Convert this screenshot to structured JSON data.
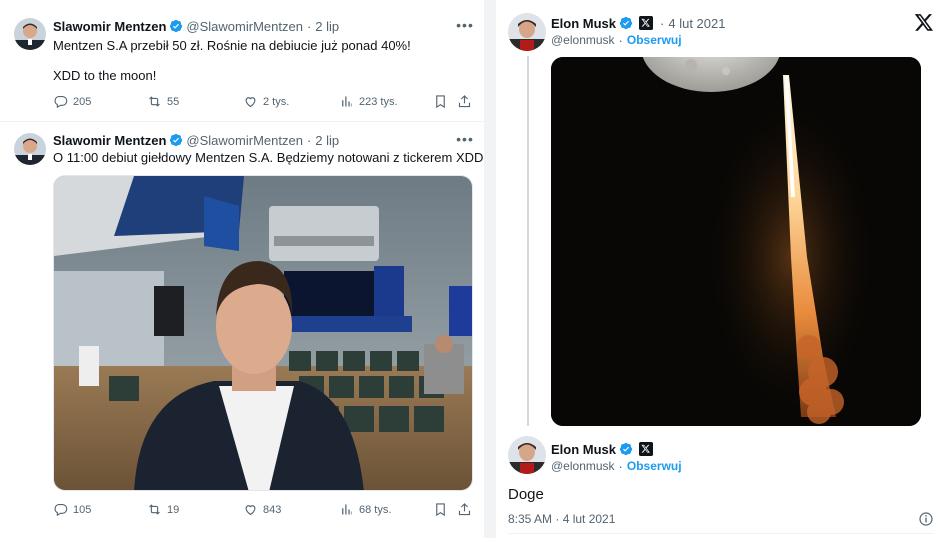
{
  "left_feed": {
    "tweets": [
      {
        "author": "Slawomir Mentzen",
        "handle": "@SlawomirMentzen",
        "separator": "·",
        "date": "2 lip",
        "line1": "Mentzen S.A przebił 50 zł. Rośnie na debiucie już ponad 40%!",
        "line2": "XDD to the moon!",
        "replies": "205",
        "retweets": "55",
        "likes": "2 tys.",
        "views": "223 tys."
      },
      {
        "author": "Slawomir Mentzen",
        "handle": "@SlawomirMentzen",
        "separator": "·",
        "date": "2 lip",
        "line1": "O 11:00 debiut giełdowy Mentzen S.A. Będziemy notowani z tickerem XDD",
        "media": "selfie-photo-exchange-hall",
        "replies": "105",
        "retweets": "19",
        "likes": "843",
        "views": "68 tys."
      }
    ]
  },
  "right_thread": {
    "first": {
      "author": "Elon Musk",
      "handle": "@elonmusk",
      "separator": "·",
      "date": "4 lut 2021",
      "follow_label": "Obserwuj",
      "media": "moon-and-rocket-launch-photo"
    },
    "second": {
      "author": "Elon Musk",
      "handle": "@elonmusk",
      "separator": "·",
      "follow_label": "Obserwuj",
      "text": "Doge",
      "timestamp": "8:35 AM · 4 lut 2021"
    },
    "logo": "x-logo-icon"
  },
  "colors": {
    "accent": "#1d9bf0",
    "text": "#0f1419",
    "muted": "#536471",
    "divider": "#eff3f4"
  }
}
